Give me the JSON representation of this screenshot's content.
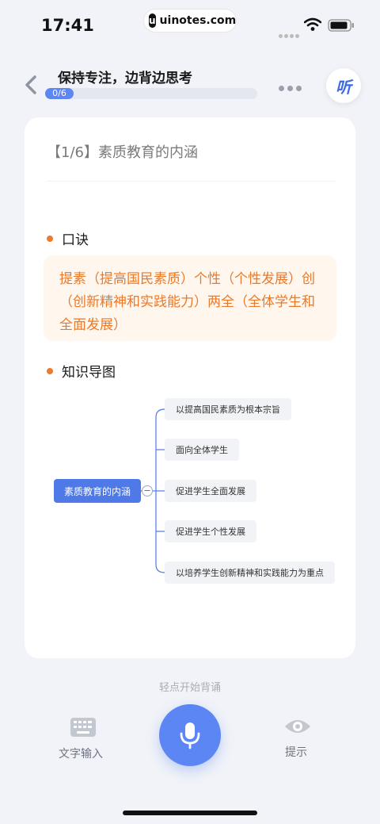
{
  "status": {
    "time": "17:41",
    "site": "uinotes.com",
    "site_logo": "u"
  },
  "header": {
    "title": "保持专注，边背边思考",
    "progress_text": "0/6",
    "progress_fraction": 0,
    "listen_label": "听"
  },
  "card": {
    "title": "【1/6】素质教育的内涵",
    "mnemonic_heading": "口诀",
    "mnemonic_text": "提素（提高国民素质）个性（个性发展）创（创新精神和实践能力）两全（全体学生和全面发展）",
    "mindmap_heading": "知识导图",
    "mindmap": {
      "root": "素质教育的内涵",
      "collapse_symbol": "−",
      "children": [
        "以提高国民素质为根本宗旨",
        "面向全体学生",
        "促进学生全面发展",
        "促进学生个性发展",
        "以培养学生创新精神和实践能力为重点"
      ]
    }
  },
  "bottom": {
    "hint": "轻点开始背诵",
    "text_input_label": "文字输入",
    "hint_button_label": "提示"
  },
  "colors": {
    "accent": "#5C86F3",
    "mnemonic_text": "#EA7A29",
    "bullet": "#EE7A2F"
  },
  "icons": [
    "back-chevron-icon",
    "more-dots-icon",
    "keyboard-icon",
    "microphone-icon",
    "eye-icon",
    "wifi-icon",
    "battery-icon"
  ]
}
